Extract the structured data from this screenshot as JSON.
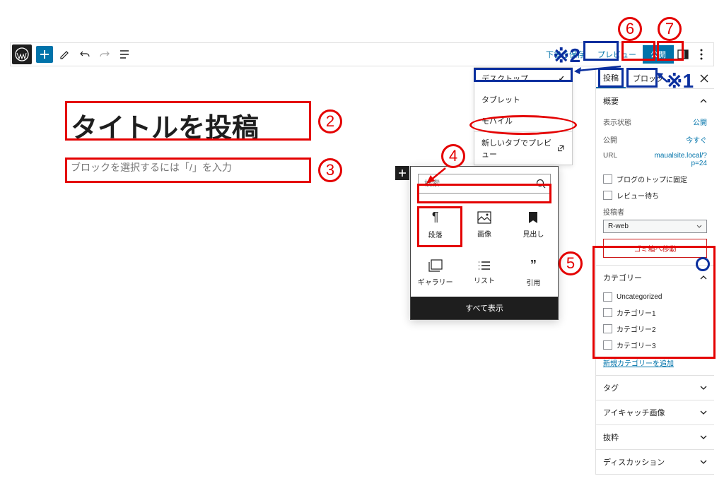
{
  "toolbar": {
    "save_draft": "下書き保存",
    "preview": "プレビュー",
    "publish": "公開"
  },
  "canvas": {
    "title": "タイトルを投稿",
    "paragraph_placeholder": "ブロックを選択するには「/」を入力"
  },
  "preview_menu": {
    "desktop": "デスクトップ",
    "tablet": "タブレット",
    "mobile": "モバイル",
    "new_tab": "新しいタブでプレビュー"
  },
  "inserter": {
    "search_placeholder": "検索",
    "blocks": {
      "paragraph": "段落",
      "image": "画像",
      "heading": "見出し",
      "gallery": "ギャラリー",
      "list": "リスト",
      "quote": "引用"
    },
    "show_all": "すべて表示"
  },
  "sidebar": {
    "tab_post": "投稿",
    "tab_block": "ブロック",
    "summary": {
      "title": "概要",
      "visibility_label": "表示状態",
      "visibility_value": "公開",
      "publish_label": "公開",
      "publish_value": "今すぐ",
      "url_label": "URL",
      "url_value": "maualsite.local/?p=24",
      "pin_to_top": "ブログのトップに固定",
      "pending_review": "レビュー待ち",
      "author_label": "投稿者",
      "author_value": "R-web",
      "move_to_trash": "ゴミ箱へ移動"
    },
    "categories": {
      "title": "カテゴリー",
      "items": [
        "Uncategorized",
        "カテゴリー1",
        "カテゴリー2",
        "カテゴリー3"
      ],
      "add_new": "新規カテゴリーを追加"
    },
    "panels": {
      "tags": "タグ",
      "featured_image": "アイキャッチ画像",
      "excerpt": "抜粋",
      "discussion": "ディスカッション"
    }
  },
  "annotations": {
    "n2": "2",
    "n3": "3",
    "n4": "4",
    "n5": "5",
    "n6": "6",
    "n7": "7",
    "x1": "※1",
    "x2": "※2"
  }
}
